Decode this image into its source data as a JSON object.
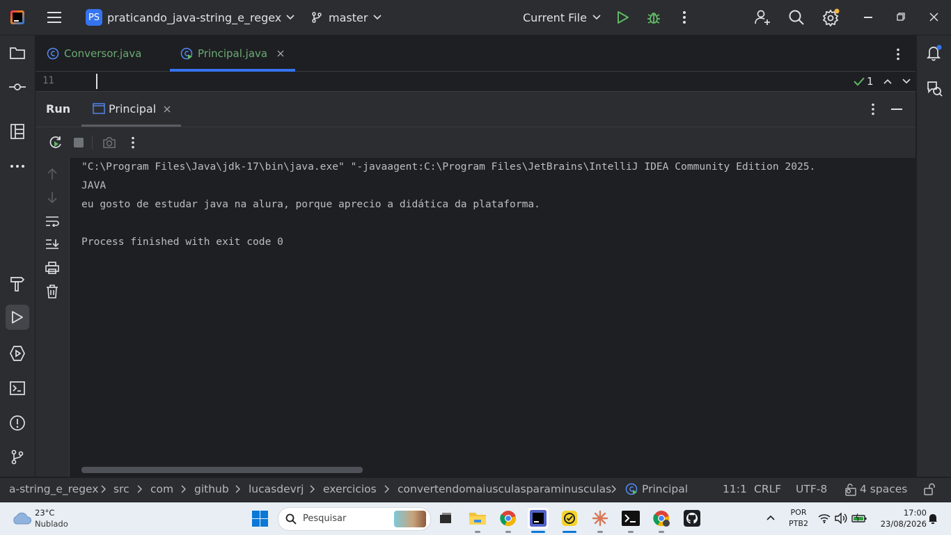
{
  "titlebar": {
    "project_badge": "PS",
    "project_name": "praticando_java-string_e_regex",
    "branch": "master",
    "run_config": "Current File"
  },
  "editor": {
    "tabs": [
      {
        "label": "Conversor.java",
        "active": false
      },
      {
        "label": "Principal.java",
        "active": true
      }
    ],
    "line_number": "11",
    "inspection_count": "1"
  },
  "run_panel": {
    "title": "Run",
    "tab_label": "Principal",
    "console_lines": [
      "\"C:\\Program Files\\Java\\jdk-17\\bin\\java.exe\" \"-javaagent:C:\\Program Files\\JetBrains\\IntelliJ IDEA Community Edition 2025.",
      "JAVA",
      "eu gosto de estudar java na alura, porque aprecio a didática da plataforma.",
      "",
      "Process finished with exit code 0"
    ]
  },
  "statusbar": {
    "breadcrumbs": [
      "a-string_e_regex",
      "src",
      "com",
      "github",
      "lucasdevrj",
      "exercicios",
      "convertendomaiusculasparaminusculas",
      "Principal"
    ],
    "position": "11:1",
    "line_sep": "CRLF",
    "encoding": "UTF-8",
    "indent": "4 spaces"
  },
  "taskbar": {
    "weather_temp": "23°C",
    "weather_desc": "Nublado",
    "search_placeholder": "Pesquisar",
    "lang": "POR",
    "layout": "PTB2",
    "time": "17:00",
    "date": "23/08/2026"
  },
  "colors": {
    "accent": "#3574f0",
    "run_green": "#5fb865",
    "console_text": "#bcbec4",
    "bg_dark": "#1e1f22",
    "bg_panel": "#2b2d30"
  }
}
